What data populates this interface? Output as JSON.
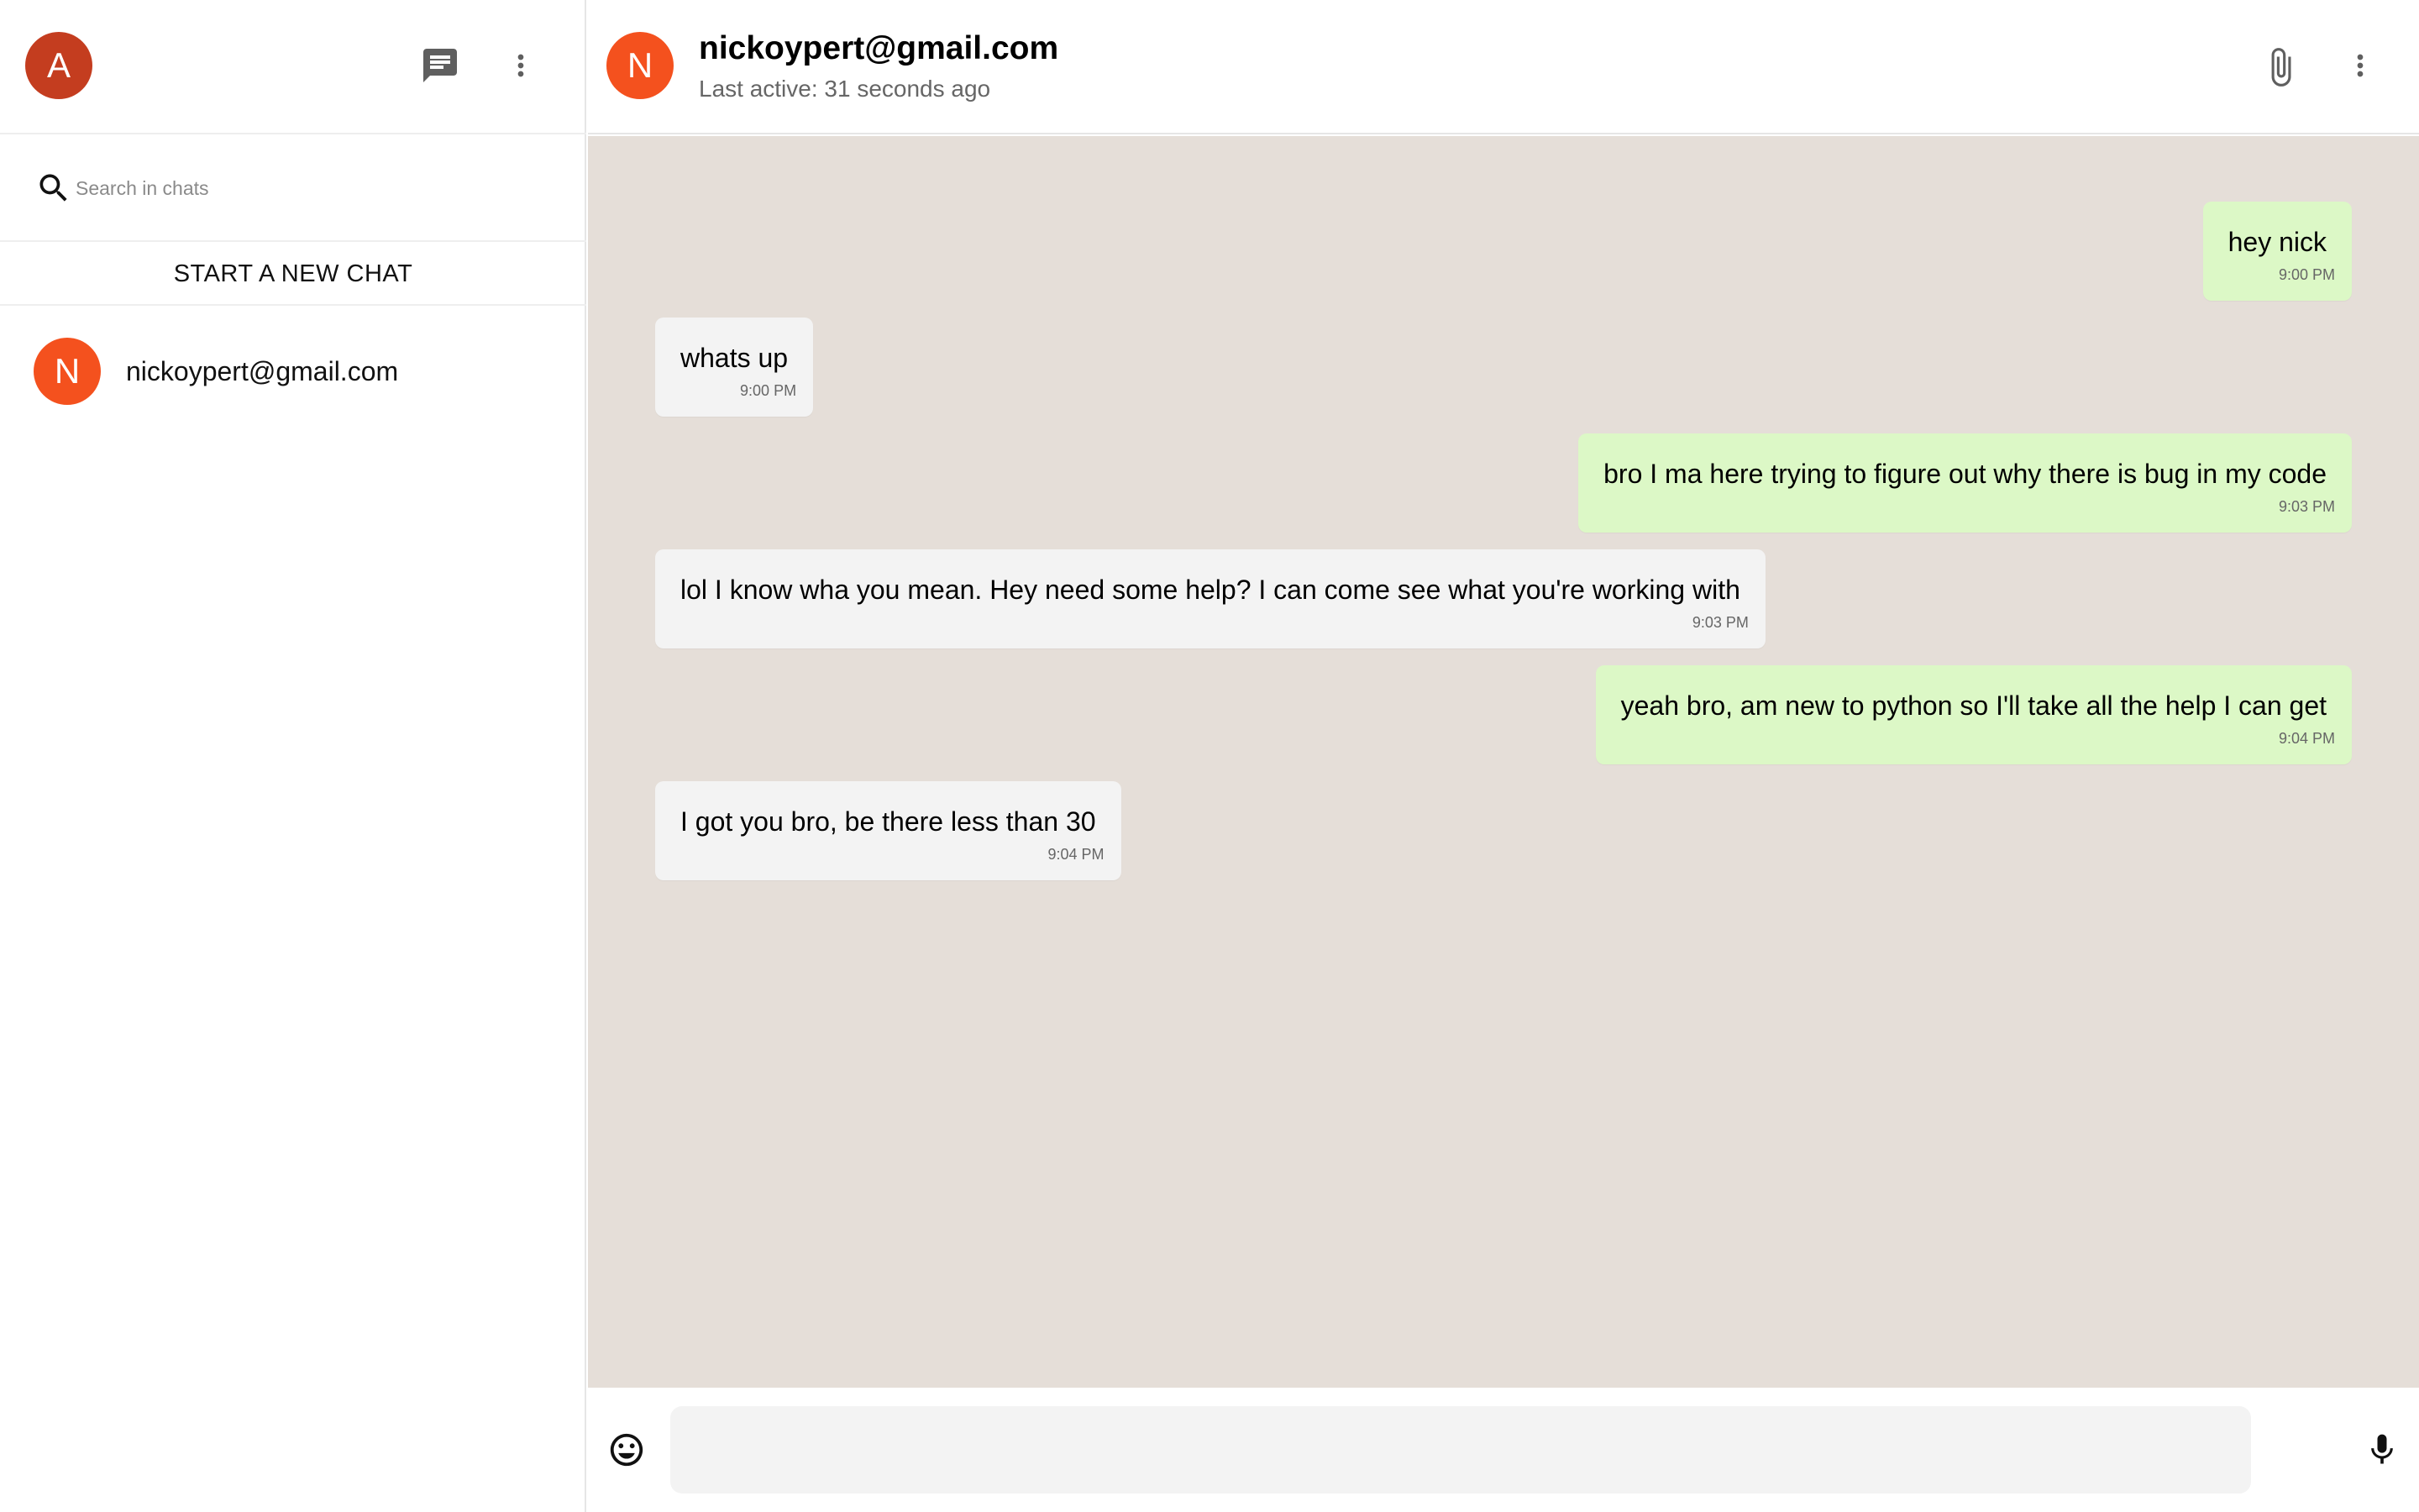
{
  "sidebar": {
    "user_avatar_letter": "A",
    "user_avatar_color": "#c43d1f",
    "search_placeholder": "Search in chats",
    "new_chat_label": "START A NEW CHAT",
    "chats": [
      {
        "avatar_letter": "N",
        "avatar_color": "#f4511e",
        "name": "nickoypert@gmail.com"
      }
    ]
  },
  "header": {
    "avatar_letter": "N",
    "title": "nickoypert@gmail.com",
    "subtitle": "Last active: 31 seconds ago"
  },
  "messages": [
    {
      "direction": "outgoing",
      "text": "hey nick",
      "time": "9:00 PM"
    },
    {
      "direction": "incoming",
      "text": "whats up",
      "time": "9:00 PM"
    },
    {
      "direction": "outgoing",
      "text": "bro I ma here trying to figure out why there is bug in my code",
      "time": "9:03 PM"
    },
    {
      "direction": "incoming",
      "text": "lol I know wha you mean. Hey need some help? I can come see what you're working with",
      "time": "9:03 PM"
    },
    {
      "direction": "outgoing",
      "text": "yeah bro, am new to python so I'll take all the help I can get",
      "time": "9:04 PM"
    },
    {
      "direction": "incoming",
      "text": "I got you bro, be there less than 30",
      "time": "9:04 PM"
    }
  ],
  "composer": {
    "value": ""
  },
  "colors": {
    "chat_background": "#e5ded8",
    "outgoing_bubble": "#dcf8c6",
    "incoming_bubble": "#f3f3f3",
    "contact_avatar": "#f4511e"
  },
  "icons": {
    "new_chat": "chat-icon",
    "sidebar_menu": "more-vert-icon",
    "search": "search-icon",
    "attach": "paperclip-icon",
    "header_menu": "more-vert-icon",
    "emoji": "emoji-icon",
    "mic": "mic-icon"
  }
}
